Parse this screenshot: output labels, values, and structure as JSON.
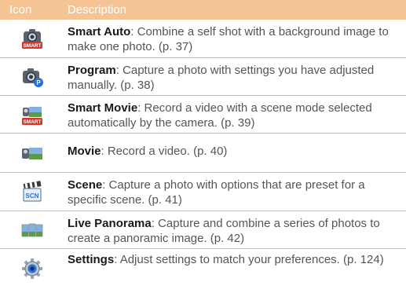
{
  "header": {
    "icon_col": "Icon",
    "desc_col": "Description"
  },
  "colors": {
    "header_bg": "#f5c494",
    "header_text": "#ffffff",
    "rule": "#bfbfbf",
    "smart_badge": "#d9342b"
  },
  "rows": [
    {
      "icon": "smart-auto-camera-icon",
      "icon_badge": "SMART",
      "title": "Smart Auto",
      "text": ": Combine a self shot with a background image to make one photo. (p. 37)"
    },
    {
      "icon": "program-camera-icon",
      "icon_badge": "P",
      "title": "Program",
      "text": ": Capture a photo with settings you have adjusted manually. (p. 38)"
    },
    {
      "icon": "smart-movie-icon",
      "icon_badge": "SMART",
      "title": "Smart Movie",
      "text": ": Record a video with a scene mode selected automatically by the camera. (p. 39)"
    },
    {
      "icon": "movie-icon",
      "title": "Movie",
      "text": ": Record a video. (p. 40)"
    },
    {
      "icon": "scene-icon",
      "icon_badge": "SCN",
      "title": "Scene",
      "text": ": Capture a photo with options that are preset for a specific scene. (p. 41)"
    },
    {
      "icon": "live-panorama-icon",
      "title": "Live Panorama",
      "text": ": Capture and combine a series of photos to create a panoramic image. (p. 42)"
    },
    {
      "icon": "settings-gear-icon",
      "title": "Settings",
      "text": ": Adjust settings to match your preferences. (p. 124)"
    }
  ]
}
